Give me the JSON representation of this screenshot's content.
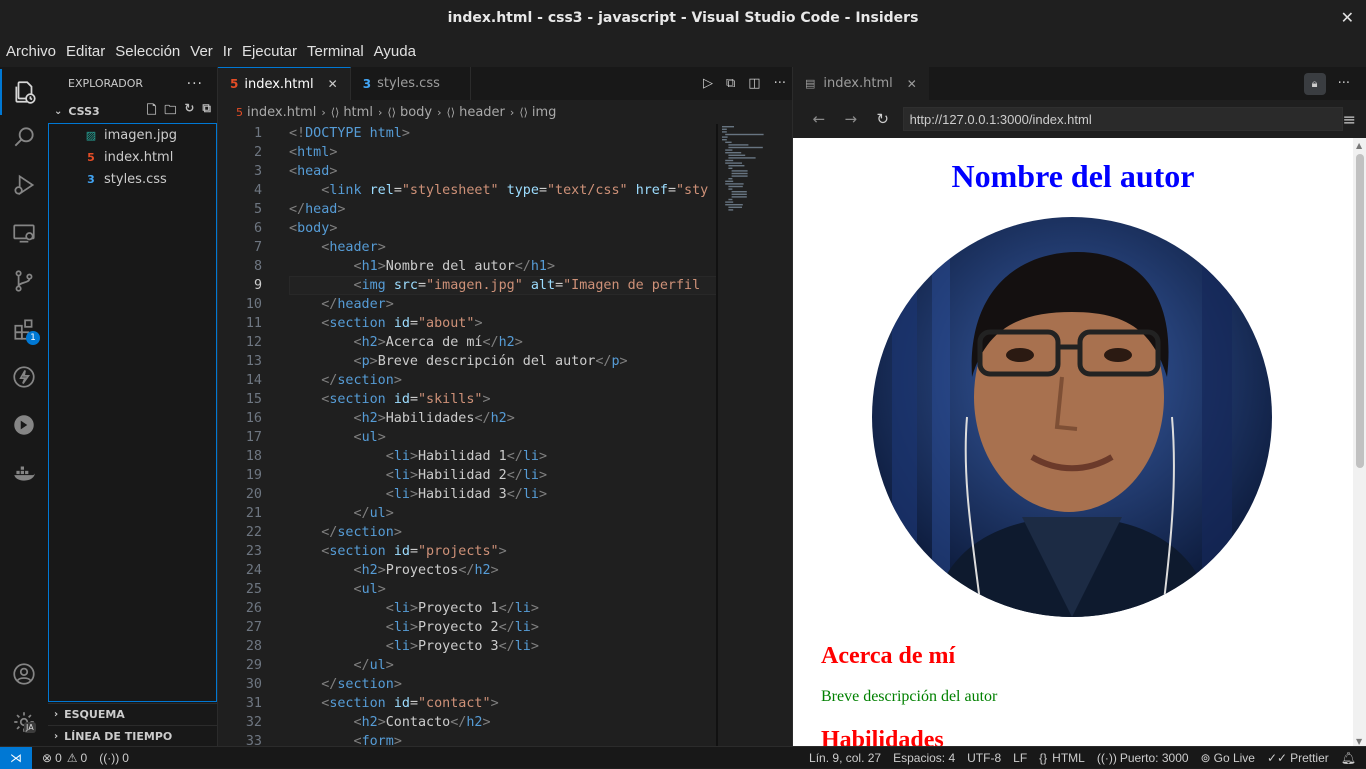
{
  "window": {
    "title": "index.html - css3 - javascript - Visual Studio Code - Insiders"
  },
  "menu": [
    "Archivo",
    "Editar",
    "Selección",
    "Ver",
    "Ir",
    "Ejecutar",
    "Terminal",
    "Ayuda"
  ],
  "activity": {
    "extensions_badge": "1",
    "account_badge": "JA"
  },
  "sidebar": {
    "title": "EXPLORADOR",
    "folder": "CSS3",
    "files": [
      {
        "name": "imagen.jpg",
        "icon": "image-file-icon"
      },
      {
        "name": "index.html",
        "icon": "html5-icon"
      },
      {
        "name": "styles.css",
        "icon": "css3-icon"
      }
    ],
    "outline": "ESQUEMA",
    "timeline": "LÍNEA DE TIEMPO"
  },
  "editor": {
    "tabs": [
      {
        "label": "index.html",
        "active": true
      },
      {
        "label": "styles.css",
        "active": false
      }
    ],
    "breadcrumb": [
      "index.html",
      "html",
      "body",
      "header",
      "img"
    ],
    "current_line": 9,
    "lines": [
      "<!DOCTYPE html>",
      "<html>",
      "<head>",
      "    <link rel=\"stylesheet\" type=\"text/css\" href=\"sty",
      "</head>",
      "<body>",
      "    <header>",
      "        <h1>Nombre del autor</h1>",
      "        <img src=\"imagen.jpg\" alt=\"Imagen de perfil",
      "    </header>",
      "    <section id=\"about\">",
      "        <h2>Acerca de mí</h2>",
      "        <p>Breve descripción del autor</p>",
      "    </section>",
      "    <section id=\"skills\">",
      "        <h2>Habilidades</h2>",
      "        <ul>",
      "            <li>Habilidad 1</li>",
      "            <li>Habilidad 2</li>",
      "            <li>Habilidad 3</li>",
      "        </ul>",
      "    </section>",
      "    <section id=\"projects\">",
      "        <h2>Proyectos</h2>",
      "        <ul>",
      "            <li>Proyecto 1</li>",
      "            <li>Proyecto 2</li>",
      "            <li>Proyecto 3</li>",
      "        </ul>",
      "    </section>",
      "    <section id=\"contact\">",
      "        <h2>Contacto</h2>",
      "        <form>"
    ]
  },
  "preview": {
    "tab_label": "index.html",
    "url": "http://127.0.0.1:3000/index.html",
    "page": {
      "h1": "Nombre del autor",
      "about_h2": "Acerca de mí",
      "about_p": "Breve descripción del autor",
      "skills_h2": "Habilidades"
    }
  },
  "status": {
    "errors": "0",
    "warnings": "0",
    "ports": "0",
    "position": "Lín. 9, col. 27",
    "spaces": "Espacios: 4",
    "encoding": "UTF-8",
    "eol": "LF",
    "language": "HTML",
    "port": "Puerto: 3000",
    "golive": "Go Live",
    "prettier": "Prettier"
  }
}
